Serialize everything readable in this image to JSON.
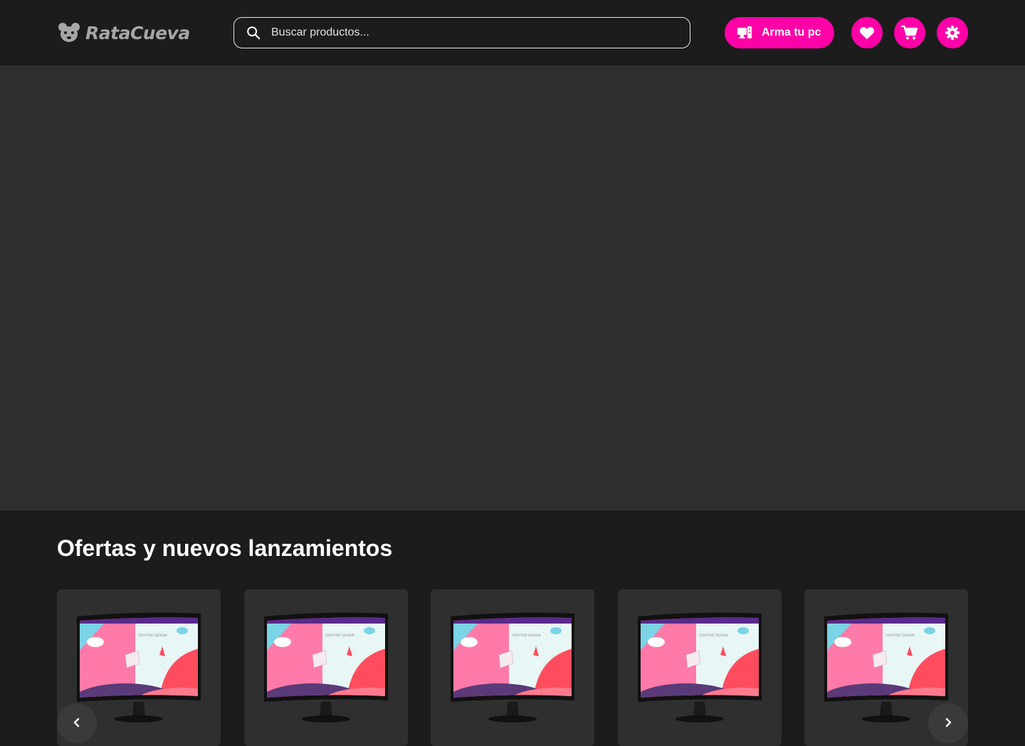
{
  "header": {
    "logo_text": "RataCueva",
    "search": {
      "placeholder": "Buscar productos...",
      "value": ""
    },
    "build_pc_label": "Arma tu pc",
    "icons": [
      "search-icon",
      "pc-build-icon",
      "heart-icon",
      "cart-icon",
      "gear-icon"
    ]
  },
  "offers": {
    "title": "Ofertas y nuevos lanzamientos",
    "products": [
      {
        "image": "monitor",
        "screen_text": "CREATIVE DESIGN"
      },
      {
        "image": "monitor",
        "screen_text": "CREATIVE DESIGN"
      },
      {
        "image": "monitor",
        "screen_text": "CREATIVE DESIGN"
      },
      {
        "image": "monitor",
        "screen_text": "CREATIVE DESIGN"
      },
      {
        "image": "monitor",
        "screen_text": "CREATIVE DESIGN"
      }
    ]
  },
  "colors": {
    "accent": "#ff00a8",
    "header_bg": "#1c1c1c",
    "hero_bg": "#2f2f2f",
    "card_bg": "#2f2f2f"
  }
}
